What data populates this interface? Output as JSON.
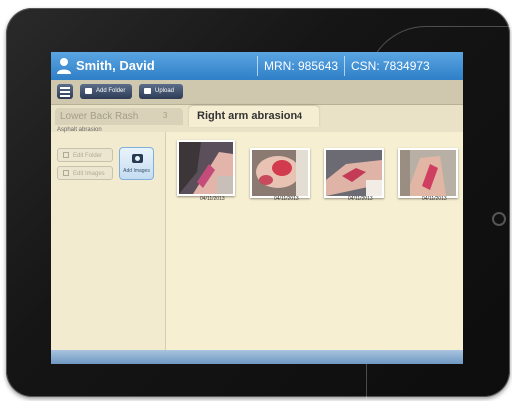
{
  "header": {
    "patient_name": "Smith, David",
    "mrn": "MRN: 985643",
    "csn": "CSN: 7834973"
  },
  "toolbar": {
    "add_folder_label": "Add Folder",
    "upload_label": "Upload"
  },
  "tabs": [
    {
      "label": "Lower Back Rash",
      "count": "3",
      "active": false
    },
    {
      "label": "Right arm abrasion",
      "count": "4",
      "active": true
    }
  ],
  "folder_subtitle": "Asphalt abrasion",
  "sidebar": {
    "edit_folder_label": "Edit Folder",
    "edit_images_label": "Edit Images",
    "add_images_label": "Add Images"
  },
  "images": [
    {
      "date": "04/11/2013"
    },
    {
      "date": "04/11/2013"
    },
    {
      "date": "04/11/2013"
    },
    {
      "date": "04/11/2013"
    }
  ],
  "colors": {
    "header_blue": "#2f7fc7",
    "panel_bg": "#f3ebcf",
    "tab_active": "#f6eed2"
  }
}
